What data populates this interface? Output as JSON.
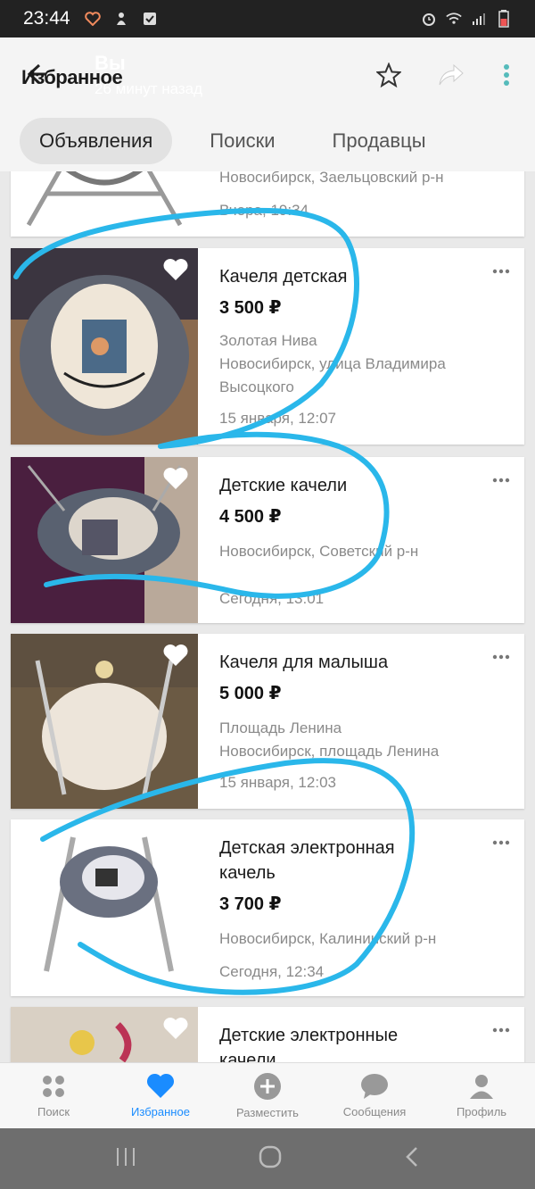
{
  "status_bar": {
    "time": "23:44"
  },
  "header": {
    "title": "Избранное",
    "chat_name": "Вы",
    "chat_time": "26 минут назад"
  },
  "tabs": [
    {
      "label": "Объявления"
    },
    {
      "label": "Поиски"
    },
    {
      "label": "Продавцы"
    }
  ],
  "listings": [
    {
      "title": "",
      "price": "",
      "address_line1": "Новосибирск, Заельцовский р-н",
      "address_line2": "",
      "date": "Вчера, 19:34"
    },
    {
      "title": "Качеля детская",
      "price": "3 500 ₽",
      "address_line1": "Золотая Нива",
      "address_line2": "Новосибирск, улица Владимира Высоцкого",
      "date": "15 января, 12:07"
    },
    {
      "title": "Детские качели",
      "price": "4 500 ₽",
      "address_line1": "Новосибирск, Советский р-н",
      "address_line2": "",
      "date": "Сегодня, 13:01"
    },
    {
      "title": "Качеля для малыша",
      "price": "5 000 ₽",
      "address_line1": "Площадь Ленина",
      "address_line2": "Новосибирск, площадь Ленина",
      "date": "15 января, 12:03"
    },
    {
      "title": "Детская электронная качель",
      "price": "3 700 ₽",
      "address_line1": "Новосибирск, Калининский р-н",
      "address_line2": "",
      "date": "Сегодня, 12:34"
    },
    {
      "title": "Детские электронные качели",
      "price": "",
      "address_line1": "",
      "address_line2": "",
      "date": ""
    }
  ],
  "bottom_nav": [
    {
      "label": "Поиск",
      "icon": "search-dots-icon"
    },
    {
      "label": "Избранное",
      "icon": "heart-icon"
    },
    {
      "label": "Разместить",
      "icon": "plus-circle-icon"
    },
    {
      "label": "Сообщения",
      "icon": "chat-bubble-icon"
    },
    {
      "label": "Профиль",
      "icon": "profile-icon"
    }
  ],
  "colors": {
    "accent": "#1a8cff",
    "annotation": "#2ab7ea",
    "text_secondary": "#8a8a8a"
  }
}
